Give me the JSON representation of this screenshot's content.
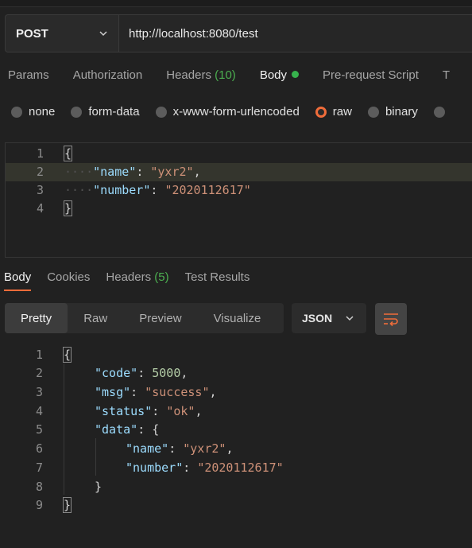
{
  "request": {
    "method": "POST",
    "url": "http://localhost:8080/test"
  },
  "request_tabs": {
    "params": "Params",
    "authorization": "Authorization",
    "headers": "Headers",
    "headers_count": "(10)",
    "body": "Body",
    "prerequest": "Pre-request Script",
    "tests_partial": "T"
  },
  "body_types": {
    "none": "none",
    "form_data": "form-data",
    "urlencoded": "x-www-form-urlencoded",
    "raw": "raw",
    "binary": "binary",
    "selected": "raw"
  },
  "request_body": {
    "line_numbers": [
      "1",
      "2",
      "3",
      "4"
    ],
    "open_brace": "{",
    "name_key": "\"name\"",
    "name_value": "\"yxr2\"",
    "number_key": "\"number\"",
    "number_value": "\"2020112617\"",
    "close_brace": "}"
  },
  "response_tabs": {
    "body": "Body",
    "cookies": "Cookies",
    "headers": "Headers",
    "headers_count": "(5)",
    "test_results": "Test Results"
  },
  "view_modes": {
    "pretty": "Pretty",
    "raw": "Raw",
    "preview": "Preview",
    "visualize": "Visualize",
    "format": "JSON"
  },
  "response_body": {
    "line_numbers": [
      "1",
      "2",
      "3",
      "4",
      "5",
      "6",
      "7",
      "8",
      "9"
    ],
    "open_brace": "{",
    "code_key": "\"code\"",
    "code_value": "5000",
    "msg_key": "\"msg\"",
    "msg_value": "\"success\"",
    "status_key": "\"status\"",
    "status_value": "\"ok\"",
    "data_key": "\"data\"",
    "data_open": "{",
    "name_key": "\"name\"",
    "name_value": "\"yxr2\"",
    "number_key": "\"number\"",
    "number_value": "\"2020112617\"",
    "data_close": "}",
    "close_brace": "}"
  },
  "colors": {
    "accent": "#ef6c3a",
    "success": "#4caf50",
    "background": "#212121"
  }
}
